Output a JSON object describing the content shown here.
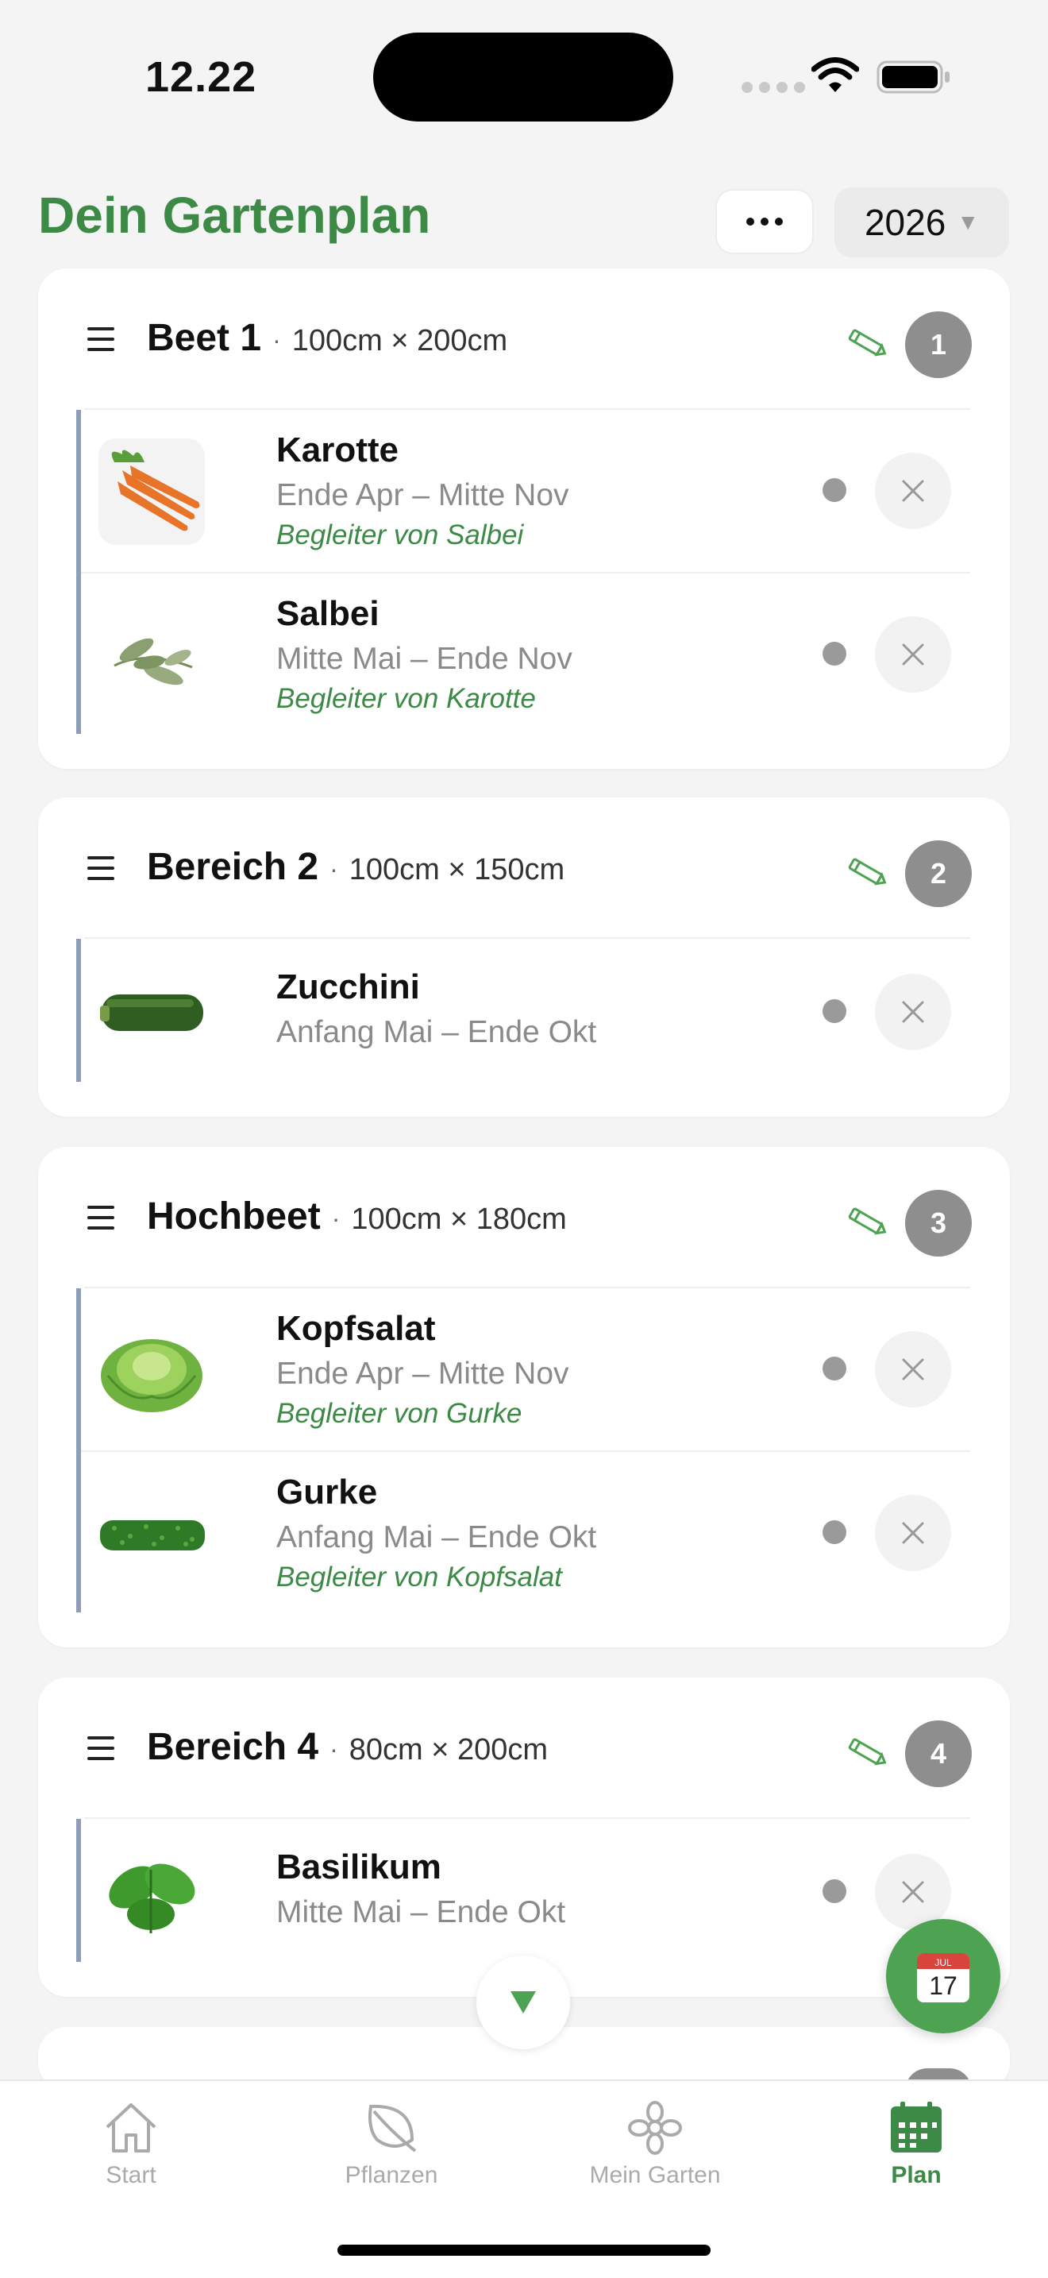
{
  "status_bar": {
    "time": "12.22"
  },
  "header": {
    "title": "Dein Gartenplan",
    "year": "2026"
  },
  "beds": [
    {
      "name": "Beet 1",
      "dimensions": "100cm × 200cm",
      "number": "1",
      "plants": [
        {
          "name": "Karotte",
          "dates": "Ende Apr – Mitte Nov",
          "companion": "Begleiter von Salbei"
        },
        {
          "name": "Salbei",
          "dates": "Mitte Mai – Ende Nov",
          "companion": "Begleiter von Karotte"
        }
      ]
    },
    {
      "name": "Bereich 2",
      "dimensions": "100cm × 150cm",
      "number": "2",
      "plants": [
        {
          "name": "Zucchini",
          "dates": "Anfang Mai – Ende Okt"
        }
      ]
    },
    {
      "name": "Hochbeet",
      "dimensions": "100cm × 180cm",
      "number": "3",
      "plants": [
        {
          "name": "Kopfsalat",
          "dates": "Ende Apr – Mitte Nov",
          "companion": "Begleiter von Gurke"
        },
        {
          "name": "Gurke",
          "dates": "Anfang Mai – Ende Okt",
          "companion": "Begleiter von Kopfsalat"
        }
      ]
    },
    {
      "name": "Bereich 4",
      "dimensions": "80cm × 200cm",
      "number": "4",
      "plants": [
        {
          "name": "Basilikum",
          "dates": "Mitte Mai – Ende Okt"
        }
      ]
    }
  ],
  "fab": {
    "calendar_month": "JUL",
    "calendar_day": "17"
  },
  "tabbar": {
    "items": [
      {
        "label": "Start",
        "icon": "home-icon"
      },
      {
        "label": "Pflanzen",
        "icon": "leaf-icon"
      },
      {
        "label": "Mein Garten",
        "icon": "flower-icon"
      },
      {
        "label": "Plan",
        "icon": "calendar-icon",
        "active": true
      }
    ]
  },
  "colors": {
    "accent": "#3d8a46",
    "fab": "#4da352",
    "bed_bar": "#8e9eb8",
    "badge": "#8e8e8e"
  }
}
